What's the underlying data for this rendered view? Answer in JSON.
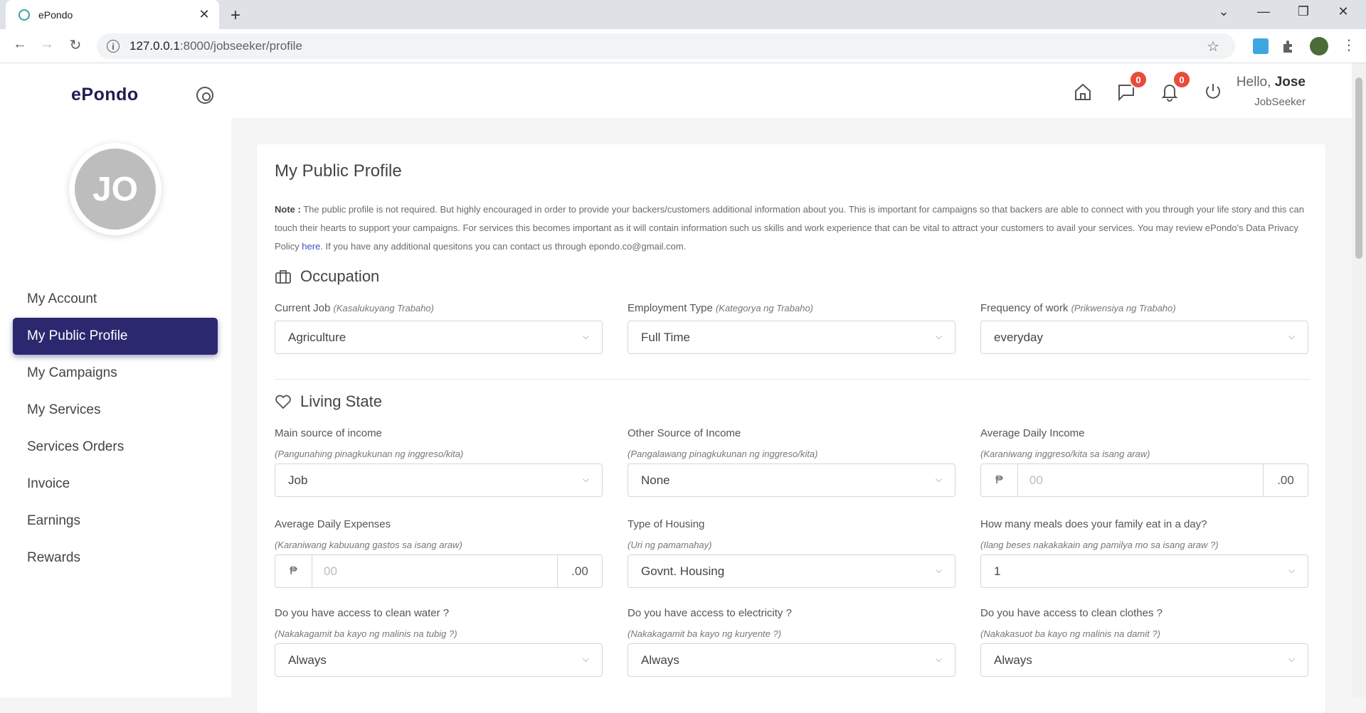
{
  "browser": {
    "tab_title": "ePondo",
    "url_host": "127.0.0.1",
    "url_rest": ":8000/jobseeker/profile"
  },
  "sidebar": {
    "brand": "ePondo",
    "avatar_initials": "JO",
    "items": [
      {
        "label": "My Account"
      },
      {
        "label": "My Public Profile",
        "active": true
      },
      {
        "label": "My Campaigns"
      },
      {
        "label": "My Services"
      },
      {
        "label": "Services Orders"
      },
      {
        "label": "Invoice"
      },
      {
        "label": "Earnings"
      },
      {
        "label": "Rewards"
      }
    ]
  },
  "topbar": {
    "messages_count": "0",
    "notifications_count": "0",
    "greeting": "Hello,",
    "user_name": "Jose",
    "role": "JobSeeker"
  },
  "profile": {
    "title": "My Public Profile",
    "note_label": "Note :",
    "note_text_1": "The public profile is not required. But highly encouraged in order to provide your backers/customers additional information about you. This is important for campaigns so that backers are able to connect with you through your life story and this can touch their hearts to support your campaigns. For services this becomes important as it will contain information such us skills and work experience that can be vital to attract your customers to avail your services. You may review ePondo's Data Privacy Policy ",
    "note_link": "here",
    "note_text_2": ". If you have any additional quesitons you can contact us through epondo.co@gmail.com.",
    "occupation": {
      "heading": "Occupation",
      "current_job_label": "Current Job",
      "current_job_hint": "(Kasalukuyang Trabaho)",
      "current_job_value": "Agriculture",
      "employment_type_label": "Employment Type",
      "employment_type_hint": "(Kategorya ng Trabaho)",
      "employment_type_value": "Full Time",
      "frequency_label": "Frequency of work",
      "frequency_hint": "(Prikwensiya ng Trabaho)",
      "frequency_value": "everyday"
    },
    "living": {
      "heading": "Living State",
      "main_income_label": "Main source of income",
      "main_income_hint": "(Pangunahing pinagkukunan ng inggreso/kita)",
      "main_income_value": "Job",
      "other_income_label": "Other Source of Income",
      "other_income_hint": "(Pangalawang pinagkukunan ng inggreso/kita)",
      "other_income_value": "None",
      "daily_income_label": "Average Daily Income",
      "daily_income_hint": "(Karaniwang inggreso/kita sa isang araw)",
      "daily_income_prefix": "₱",
      "daily_income_placeholder": "00",
      "daily_income_suffix": ".00",
      "daily_expenses_label": "Average Daily Expenses",
      "daily_expenses_hint": "(Karaniwang kabuuang gastos sa isang araw)",
      "daily_expenses_prefix": "₱",
      "daily_expenses_placeholder": "00",
      "daily_expenses_suffix": ".00",
      "housing_label": "Type of Housing",
      "housing_hint": "(Uri ng pamamahay)",
      "housing_value": "Govnt. Housing",
      "meals_label": "How many meals does your family eat in a day?",
      "meals_hint": "(Ilang beses nakakakain ang pamilya mo sa isang araw ?)",
      "meals_value": "1",
      "water_label": "Do you have access to clean water ?",
      "water_hint": "(Nakakagamit ba kayo ng malinis na tubig ?)",
      "water_value": "Always",
      "electricity_label": "Do you have access to electricity ?",
      "electricity_hint": "(Nakakagamit ba kayo ng kuryente ?)",
      "electricity_value": "Always",
      "clothes_label": "Do you have access to clean clothes ?",
      "clothes_hint": "(Nakakasuot ba kayo ng malinis na damit ?)",
      "clothes_value": "Always"
    }
  }
}
